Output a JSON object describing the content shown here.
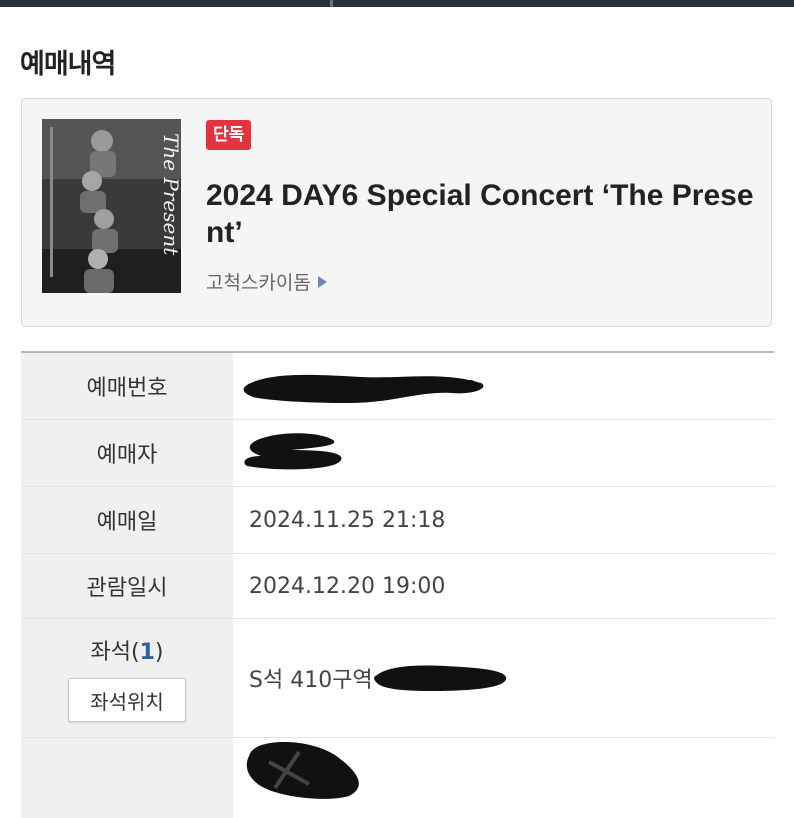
{
  "page": {
    "title": "예매내역"
  },
  "event": {
    "badge": "단독",
    "title": "2024 DAY6 Special Concert ‘The Present’",
    "venue": "고척스카이돔",
    "poster_text": "The Present"
  },
  "details": {
    "booking_number": {
      "label": "예매번호",
      "value": ""
    },
    "booker": {
      "label": "예매자",
      "value": ""
    },
    "booking_date": {
      "label": "예매일",
      "value": "2024.11.25 21:18"
    },
    "show_datetime": {
      "label": "관람일시",
      "value": "2024.12.20 19:00"
    },
    "seat": {
      "label": "좌석",
      "count": "1",
      "map_button": "좌석위치",
      "value": "S석 410구역"
    },
    "last_row": {
      "label": "",
      "value": ""
    }
  },
  "colors": {
    "badge": "#e2333f",
    "seat_count": "#2f5ea8",
    "venue_arrow": "#6a8ab4"
  },
  "icons": {
    "venue_arrow": "triangle-right-icon"
  }
}
